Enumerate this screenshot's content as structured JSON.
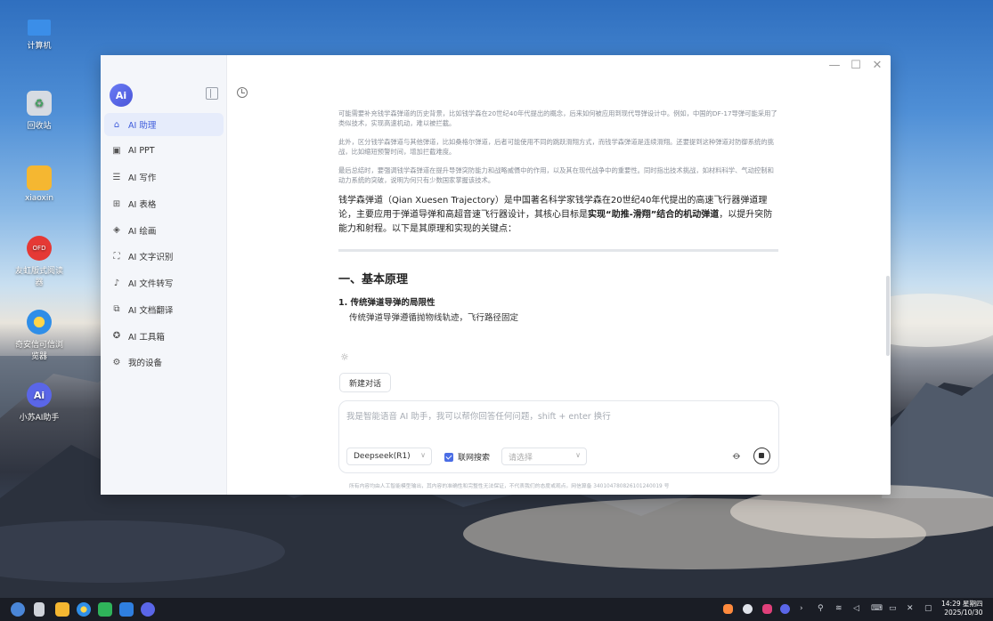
{
  "desktop": {
    "icons": [
      {
        "label": "计算机"
      },
      {
        "label": "回收站"
      },
      {
        "label": "xiaoxin"
      },
      {
        "label": "友虹版式阅读器"
      },
      {
        "label": "奇安信可信浏览器"
      },
      {
        "label": "小苏AI助手"
      }
    ]
  },
  "app": {
    "logo_text": "Ai",
    "window_controls": {
      "minimize": "—",
      "maximize": "☐",
      "close": "✕"
    },
    "nav": [
      {
        "label": "AI 助理",
        "icon": "assistant-icon"
      },
      {
        "label": "AI PPT",
        "icon": "ppt-icon"
      },
      {
        "label": "AI 写作",
        "icon": "writing-icon"
      },
      {
        "label": "AI 表格",
        "icon": "table-icon"
      },
      {
        "label": "AI 绘画",
        "icon": "paint-icon"
      },
      {
        "label": "AI 文字识别",
        "icon": "ocr-icon"
      },
      {
        "label": "AI 文件转写",
        "icon": "transcribe-icon"
      },
      {
        "label": "AI 文档翻译",
        "icon": "translate-icon"
      },
      {
        "label": "AI 工具箱",
        "icon": "toolbox-icon"
      },
      {
        "label": "我的设备",
        "icon": "device-icon"
      }
    ]
  },
  "chat": {
    "thinking": [
      "可能需要补充钱学森弹道的历史背景，比如钱学森在20世纪40年代提出的概念，后来如何被应用到现代导弹设计中。例如，中国的DF-17导弹可能采用了类似技术，实现高速机动，难以被拦截。",
      "此外，区分钱学森弹道与其他弹道，比如桑格尔弹道，后者可能使用不同的跳跃滑翔方式，而钱学森弹道是连续滑翔。还要提到这种弹道对防御系统的挑战，比如缩短预警时间，增加拦截难度。",
      "最后总结时，要强调钱学森弹道在提升导弹突防能力和战略威慑中的作用，以及其在现代战争中的重要性。同时指出技术挑战，如材料科学、气动控制和动力系统的突破，说明为何只有少数国家掌握该技术。"
    ],
    "answer_part1": "钱学森弹道（Qian Xuesen Trajectory）是中国著名科学家钱学森在20世纪40年代提出的高速飞行器弹道理论，主要应用于弹道导弹和高超音速飞行器设计，其核心目标是",
    "answer_bold": "实现“助推-滑翔”结合的机动弹道",
    "answer_part2": "，以提升突防能力和射程。以下是其原理和实现的关键点：",
    "section_title": "一、基本原理",
    "list_item_title": "1. 传统弹道导弹的局限性",
    "list_item_sub": "传统弹道导弹遵循抛物线轨迹，飞行路径固定",
    "loading_glyph": "☼"
  },
  "composer": {
    "new_chat_label": "新建对话",
    "placeholder": "我是智能语音 AI 助手，我可以帮你回答任何问题，shift + enter 换行",
    "model": "Deepseek(R1)",
    "web_search_label": "联网搜索",
    "region_placeholder": "请选择",
    "disclaimer": "所有内容均由人工智能模型输出，其内容的准确性和完整性无法保证，不代表我们的态度或观点。网信算备 340104780826101240019 号"
  },
  "taskbar": {
    "time": "14:29 星期四",
    "date": "2025/10/30"
  }
}
